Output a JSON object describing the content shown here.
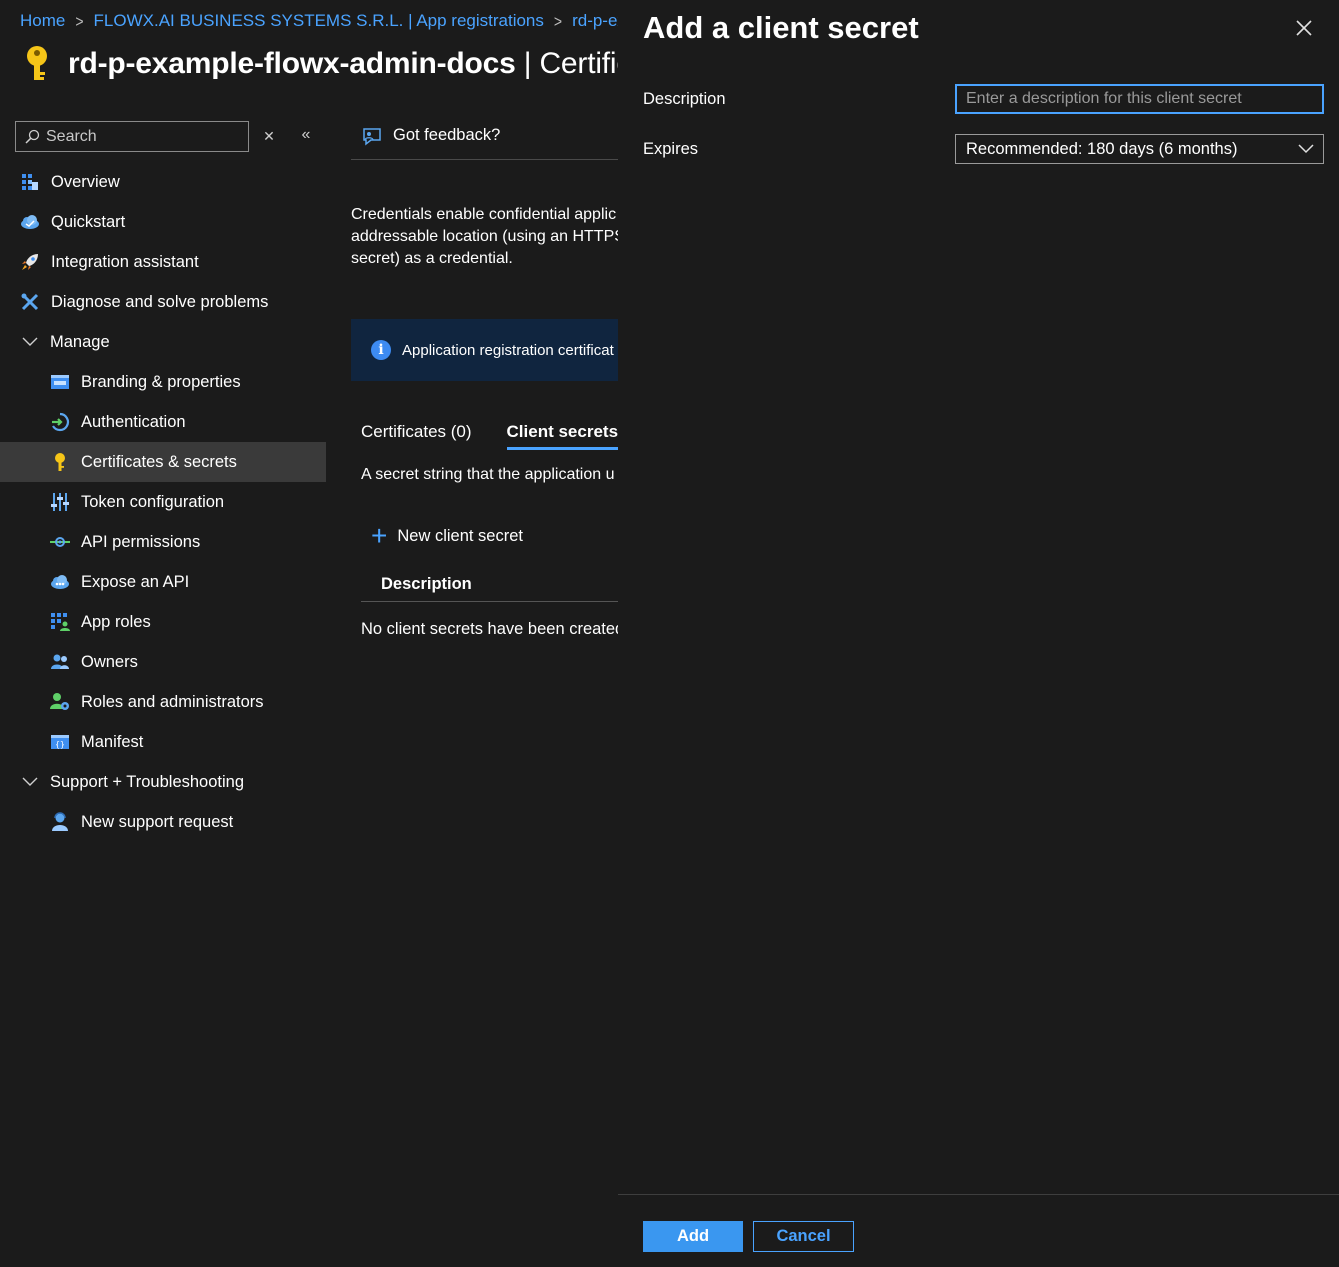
{
  "breadcrumb": {
    "items": [
      "Home",
      "FLOWX.AI BUSINESS SYSTEMS S.R.L. | App registrations",
      "rd-p-exar"
    ]
  },
  "page": {
    "title_bold": "rd-p-example-flowx-admin-docs",
    "title_rest": " | Certific"
  },
  "sidebar": {
    "search_placeholder": "Search",
    "items": [
      {
        "label": "Overview",
        "icon": "overview-icon"
      },
      {
        "label": "Quickstart",
        "icon": "quickstart-icon"
      },
      {
        "label": "Integration assistant",
        "icon": "rocket-icon"
      },
      {
        "label": "Diagnose and solve problems",
        "icon": "wrench-icon"
      },
      {
        "label": "Manage",
        "icon": "chevron-down-icon"
      },
      {
        "label": "Branding & properties",
        "icon": "branding-icon"
      },
      {
        "label": "Authentication",
        "icon": "authentication-icon"
      },
      {
        "label": "Certificates & secrets",
        "icon": "key-icon"
      },
      {
        "label": "Token configuration",
        "icon": "token-icon"
      },
      {
        "label": "API permissions",
        "icon": "api-permissions-icon"
      },
      {
        "label": "Expose an API",
        "icon": "cloud-icon"
      },
      {
        "label": "App roles",
        "icon": "app-roles-icon"
      },
      {
        "label": "Owners",
        "icon": "owners-icon"
      },
      {
        "label": "Roles and administrators",
        "icon": "roles-icon"
      },
      {
        "label": "Manifest",
        "icon": "manifest-icon"
      },
      {
        "label": "Support + Troubleshooting",
        "icon": "chevron-down-icon"
      },
      {
        "label": "New support request",
        "icon": "support-icon"
      }
    ]
  },
  "main": {
    "feedback": "Got feedback?",
    "description_lines": [
      "Credentials enable confidential applic",
      "addressable location (using an HTTPS",
      "secret) as a credential."
    ],
    "info": "Application registration certificat",
    "tabs": [
      "Certificates (0)",
      "Client secrets ("
    ],
    "secret_desc": "A secret string that the application u",
    "new_secret": "New client secret",
    "column_description": "Description",
    "empty": "No client secrets have been created"
  },
  "panel": {
    "title": "Add a client secret",
    "description_label": "Description",
    "description_placeholder": "Enter a description for this client secret",
    "expires_label": "Expires",
    "expires_value": "Recommended: 180 days (6 months)",
    "add": "Add",
    "cancel": "Cancel"
  },
  "colors": {
    "accent": "#4aa3ff",
    "primary_button": "#3a97f0",
    "background": "#1b1b1b",
    "active_nav": "#3a3a3a",
    "info_bar": "#10253f",
    "key_yellow": "#f5c518"
  }
}
